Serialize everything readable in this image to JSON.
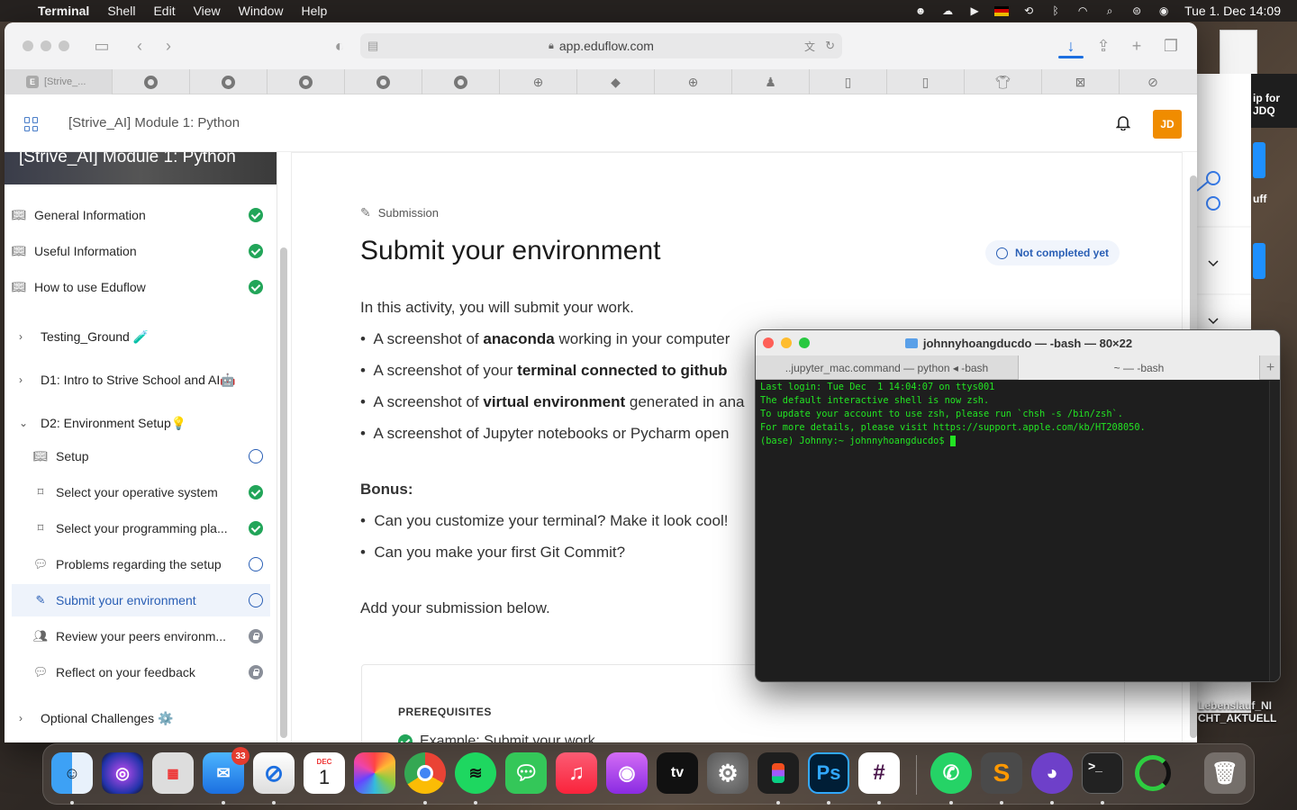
{
  "menubar": {
    "app": "Terminal",
    "items": [
      "Shell",
      "Edit",
      "View",
      "Window",
      "Help"
    ],
    "clock": "Tue 1. Dec  14:09"
  },
  "browser": {
    "url": "app.eduflow.com",
    "first_tab": "[Strive_...",
    "first_tab_favicon": "E"
  },
  "app": {
    "breadcrumb": "[Strive_AI] Module 1: Python",
    "avatar": "JD",
    "banner": "[Strive_AI] Module 1: Python"
  },
  "sidebar": {
    "top_items": [
      {
        "label": "General Information",
        "status": "done",
        "icon": "book-icon"
      },
      {
        "label": "Useful Information",
        "status": "done",
        "icon": "book-icon"
      },
      {
        "label": "How to use Eduflow",
        "status": "done",
        "icon": "book-icon"
      }
    ],
    "sections": [
      {
        "label": "Testing_Ground 🧪",
        "expanded": false
      },
      {
        "label": "D1: Intro to Strive School and AI🤖",
        "expanded": false
      },
      {
        "label": "D2: Environment Setup💡",
        "expanded": true
      }
    ],
    "d2_items": [
      {
        "label": "Setup",
        "status": "open",
        "icon": "book-icon"
      },
      {
        "label": "Select your operative system",
        "status": "done",
        "icon": "tag-icon"
      },
      {
        "label": "Select your programming pla...",
        "status": "done",
        "icon": "tag-icon"
      },
      {
        "label": "Problems regarding the setup",
        "status": "open",
        "icon": "chat-icon"
      },
      {
        "label": "Submit your environment",
        "status": "open",
        "icon": "pen-icon",
        "active": true
      },
      {
        "label": "Review your peers environm...",
        "status": "locked",
        "icon": "people-icon"
      },
      {
        "label": "Reflect on your feedback",
        "status": "locked",
        "icon": "chat-icon"
      }
    ],
    "last_section": "Optional Challenges ⚙️"
  },
  "main": {
    "type_label": "Submission",
    "title": "Submit your environment",
    "status": "Not completed yet",
    "intro": "In this activity, you will submit your work.",
    "bullets": [
      {
        "pre": "A screenshot of ",
        "bold": "anaconda",
        "post": " working in your computer"
      },
      {
        "pre": "A screenshot of your ",
        "bold": "terminal connected to github",
        "post": ""
      },
      {
        "pre": "A screenshot of ",
        "bold": "virtual environment",
        "post": " generated in ana"
      },
      {
        "pre": "A screenshot of Jupyter notebooks or Pycharm open",
        "bold": "",
        "post": ""
      }
    ],
    "bonus_label": "Bonus:",
    "bonus_bullets": [
      "Can you customize your terminal? Make it look cool!",
      "Can you make your first Git Commit?"
    ],
    "add_text": "Add your submission below.",
    "prereq_label": "PREREQUISITES",
    "prereq_item": "Example: Submit your work"
  },
  "background": {
    "window_text": "ip for\nJDQ",
    "window_text2": "uff",
    "download_label": "Lebenslauf_NI\nCHT_AKTUELL"
  },
  "terminal": {
    "title": "johnnyhoangducdo — -bash — 80×22",
    "tab1": "..jupyter_mac.command — python ◂ -bash",
    "tab2": "~ — -bash",
    "lines": [
      "Last login: Tue Dec  1 14:04:07 on ttys001",
      "",
      "The default interactive shell is now zsh.",
      "To update your account to use zsh, please run `chsh -s /bin/zsh`.",
      "For more details, please visit https://support.apple.com/kb/HT208050."
    ],
    "prompt": "(base) Johnny:~ johnnyhoangducdo$ "
  },
  "dock": {
    "apps": [
      "Finder",
      "Siri",
      "Launchpad",
      "Mail",
      "Safari",
      "Calendar",
      "Photos",
      "Chrome",
      "Spotify",
      "Messages",
      "Music",
      "Podcasts",
      "TV",
      "System Preferences",
      "Figma",
      "Photoshop",
      "Slack",
      "WhatsApp",
      "Sublime Text",
      "GitHub Desktop",
      "Terminal",
      "Activity",
      "Trash"
    ],
    "mail_badge": "33",
    "calendar_month": "DEC",
    "calendar_day": "1",
    "tv_label": "tv",
    "ps_label": "Ps"
  },
  "colors": {
    "accent": "#2a5fb5",
    "success": "#22a559",
    "avatar": "#f08c00",
    "terminal_text": "#23e323"
  }
}
